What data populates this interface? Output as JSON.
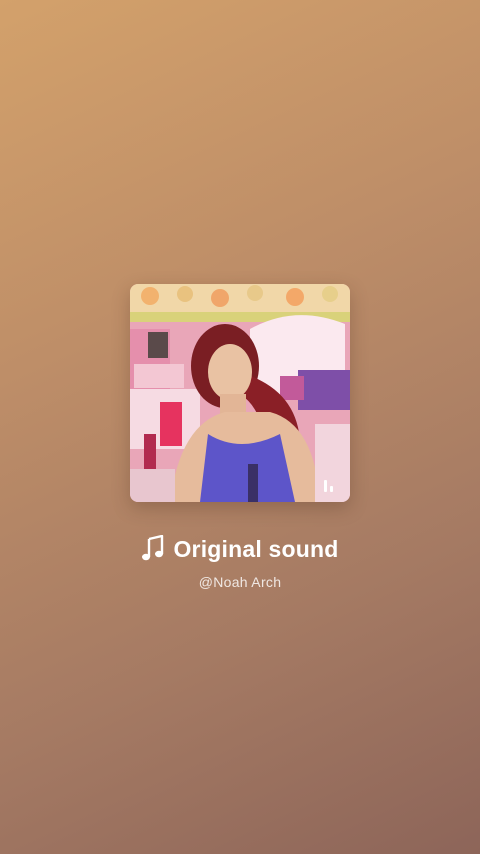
{
  "sound": {
    "title": "Original sound",
    "author": "@Noah Arch",
    "note_icon": "music-note-icon",
    "playing_icon": "audio-bars-icon"
  },
  "colors": {
    "background_top": "#d3a16b",
    "background_bottom": "#8d6559",
    "text": "#ffffff"
  }
}
